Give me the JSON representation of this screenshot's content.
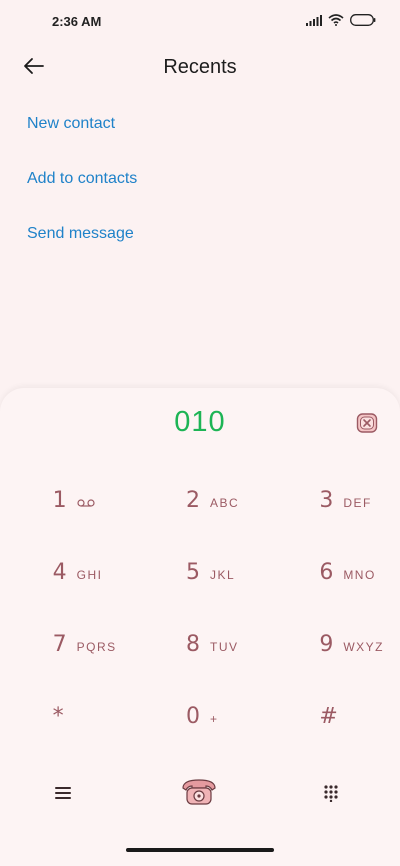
{
  "status": {
    "time": "2:36 AM",
    "icons": [
      "signal-icon",
      "wifi-icon",
      "battery-icon"
    ]
  },
  "header": {
    "title": "Recents",
    "back_icon": "back-arrow-icon"
  },
  "actions": {
    "new_contact": "New contact",
    "add_to_contacts": "Add to contacts",
    "send_message": "Send message"
  },
  "dialpad": {
    "number": "010",
    "keys": [
      {
        "digit": "1",
        "letters": ""
      },
      {
        "digit": "2",
        "letters": "ABC"
      },
      {
        "digit": "3",
        "letters": "DEF"
      },
      {
        "digit": "4",
        "letters": "GHI"
      },
      {
        "digit": "5",
        "letters": "JKL"
      },
      {
        "digit": "6",
        "letters": "MNO"
      },
      {
        "digit": "7",
        "letters": "PQRS"
      },
      {
        "digit": "8",
        "letters": "TUV"
      },
      {
        "digit": "9",
        "letters": "WXYZ"
      },
      {
        "digit": "*",
        "letters": ""
      },
      {
        "digit": "0",
        "letters": "+"
      },
      {
        "digit": "#",
        "letters": ""
      }
    ]
  },
  "colors": {
    "accent_link": "#1f82c9",
    "dial_number": "#1db455",
    "key_text": "#9b5a63",
    "background": "#fcf2f2"
  }
}
